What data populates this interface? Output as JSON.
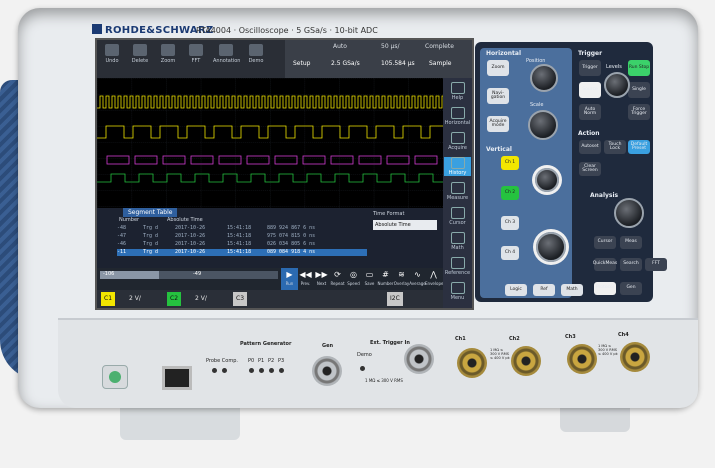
{
  "header": {
    "brand": "ROHDE&SCHWARZ",
    "model": "RTA4004 · Oscilloscope · 5 GSa/s · 10-bit ADC"
  },
  "toolbar": {
    "buttons": [
      "Undo",
      "Delete",
      "Zoom",
      "FFT",
      "Annotation",
      "Demo"
    ],
    "acquisition": {
      "headers": [
        "Auto",
        "50 µs/",
        "Complete"
      ],
      "values": [
        "Setup",
        "2.5 GSa/s",
        "105.584 µs",
        "Sample"
      ]
    }
  },
  "side_menu": {
    "items": [
      "Help",
      "Horizontal",
      "Acquire",
      "History",
      "Measure",
      "Cursor",
      "Math",
      "Reference",
      "Menu"
    ]
  },
  "segment_table": {
    "tab_label": "Segment Table",
    "time_format_label": "Time Format",
    "time_format_value": "Absolute Time",
    "columns": [
      "Number",
      "Absolute Time"
    ],
    "rows": [
      {
        "num": "-48",
        "trig": "Trg d",
        "date": "2017-10-26",
        "time": "15:41:18",
        "val": "889 924 867 6 ns"
      },
      {
        "num": "-47",
        "trig": "Trg d",
        "date": "2017-10-26",
        "time": "15:41:18",
        "val": "975 074 815 0 ns"
      },
      {
        "num": "-46",
        "trig": "Trg d",
        "date": "2017-10-26",
        "time": "15:41:18",
        "val": "026 034 805 6 ns"
      },
      {
        "num": "-11",
        "trig": "Trg d",
        "date": "2017-10-26",
        "time": "15:41:18",
        "val": "089 084 918 4 ns"
      }
    ],
    "selected_row": 3
  },
  "playback": {
    "slider_left": "-106",
    "slider_mid": "-49",
    "slider_progress": 0.33,
    "buttons": [
      "Run",
      "Prev.",
      "Next",
      "Repeat",
      "Speed",
      "Save",
      "Number",
      "Overlay",
      "Average",
      "Envelope"
    ]
  },
  "channels": [
    {
      "name": "C1",
      "scale": "2 V/",
      "color": "#f2e600"
    },
    {
      "name": "C2",
      "scale": "2 V/",
      "color": "#25c23f"
    },
    {
      "name": "C3",
      "scale": "",
      "color": "#c8c8c8"
    },
    {
      "name": "I2C",
      "scale": "",
      "color": "#c8c8c8"
    }
  ],
  "panel": {
    "horizontal_label": "Horizontal",
    "horizontal_buttons": [
      "Zoom",
      "Navi-gation",
      "Acquire mode"
    ],
    "position_label": "Position",
    "scale_label": "Scale",
    "vertical_label": "Vertical",
    "vertical_buttons": [
      "Ch 1",
      "Ch 2",
      "Ch 3",
      "Ch 4"
    ],
    "vertical_bottom": [
      "Logic",
      "Ref",
      "Math"
    ],
    "trigger_label": "Trigger",
    "trigger_buttons": [
      "Trigger",
      "Run Stop",
      "Source",
      "Single",
      "Auto Norm",
      "Force Trigger"
    ],
    "level_label": "Levels",
    "action_label": "Action",
    "action_buttons": [
      "Autoset",
      "Touch Lock",
      "Clear Screen",
      "Default Preset"
    ],
    "analysis_label": "Analysis",
    "analysis_buttons": [
      "Cursor",
      "Meas",
      "QuickMeas",
      "Search",
      "FFT",
      "Protocol",
      "Gen"
    ]
  },
  "front": {
    "pattern_generator": "Pattern Generator",
    "probe_comp": "Probe Comp.",
    "pattern_pins": [
      "P0",
      "P1",
      "P2",
      "P3"
    ],
    "gen": "Gen",
    "demo": "Demo",
    "ext_trigger": "Ext. Trigger In",
    "ext_spec": "1 MΩ ≤ 300 V RMS",
    "inputs": [
      "Ch1",
      "Ch2",
      "Ch3",
      "Ch4"
    ],
    "input_spec": "1 MΩ ≤ 300 V RMS ≤ 400 V pk"
  },
  "colors": {
    "ch1": "#f2e600",
    "ch2": "#25c23f",
    "accent": "#3aa0e0",
    "bus": "#d23bd2"
  }
}
